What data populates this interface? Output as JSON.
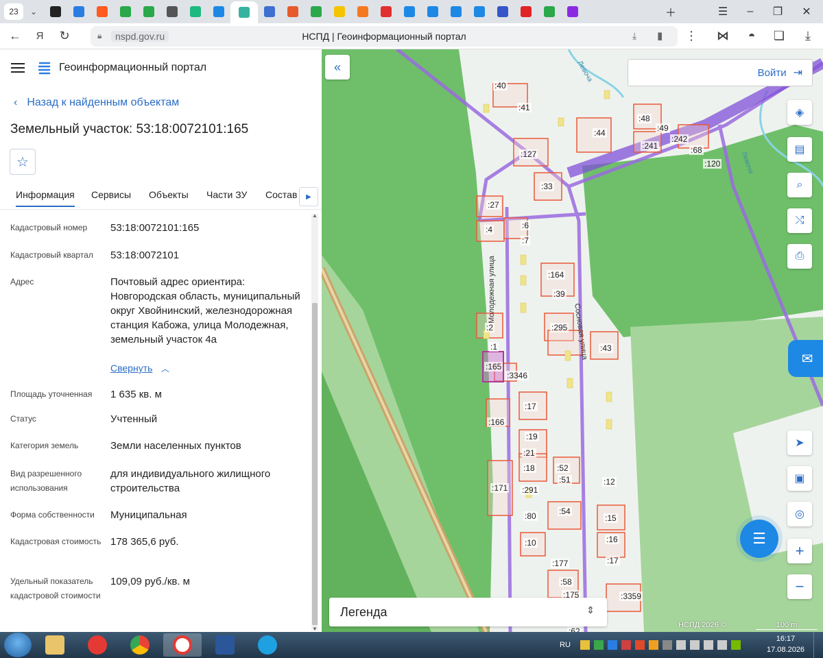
{
  "browser": {
    "tab_count": "23",
    "page_title": "НСПД | Геоинформационный портал",
    "url": "nspd.gov.ru",
    "favicon_colors": [
      "#222222",
      "#2a7de1",
      "#ff5a1f",
      "#2aa84a",
      "#2aa84a",
      "#555555",
      "#1eb980",
      "#1e88e5",
      "#35b3a0",
      "#3f6fd1",
      "#e65a2b",
      "#2aa84a",
      "#f5c400",
      "#f57a1f",
      "#e03030",
      "#1e88e5",
      "#1e88e5",
      "#1e88e5",
      "#1e88e5",
      "#3555c8",
      "#e02424",
      "#2aa84a",
      "#8a2be2"
    ]
  },
  "panel": {
    "portal_name": "Геоинформационный портал",
    "back_link": "Назад к найденным объектам",
    "title": "Земельный участок: 53:18:0072101:165",
    "tabs": [
      "Информация",
      "Сервисы",
      "Объекты",
      "Части ЗУ",
      "Состав"
    ],
    "fields": [
      {
        "label": "Кадастровый номер",
        "value": "53:18:0072101:165"
      },
      {
        "label": "Кадастровый квартал",
        "value": "53:18:0072101"
      },
      {
        "label": "Адрес",
        "value": "Почтовый адрес ориентира: Новгородская область, муниципальный округ Хвойнинский, железнодорожная станция Кабожа, улица Молодежная, земельный участок 4а",
        "action": "Свернуть"
      },
      {
        "label": "Площадь уточненная",
        "value": "1 635 кв. м"
      },
      {
        "label": "Статус",
        "value": "Учтенный"
      },
      {
        "label": "Категория земель",
        "value": "Земли населенных пунктов"
      },
      {
        "label": "Вид разрешенного использования",
        "value": "для индивидуального жилищного строительства"
      },
      {
        "label": "Форма собственности",
        "value": "Муниципальная"
      },
      {
        "label": "Кадастровая стоимость",
        "value": "178 365,6 руб."
      },
      {
        "label": "Удельный показатель кадастровой стоимости",
        "value": "109,09 руб./кв. м"
      }
    ]
  },
  "map": {
    "login": "Войти",
    "legend": "Легенда",
    "attribution": "НСПД 2026 ©",
    "scale": "100 m",
    "streets": [
      "Молодежная улица",
      "Сосновая улица",
      "Левоча",
      "Левоча"
    ],
    "parcels": [
      ":40",
      ":41",
      ":44",
      ":48",
      ":49",
      ":241",
      ":242",
      ":68",
      ":120",
      ":127",
      ":33",
      ":27",
      ":4",
      ":6",
      ":7",
      ":164",
      ":39",
      ":2",
      ":295",
      ":43",
      ":1",
      ":165",
      ":3346",
      ":17",
      ":166",
      ":19",
      ":21",
      ":18",
      ":52",
      ":51",
      ":12",
      ":171",
      ":291",
      ":54",
      ":80",
      ":15",
      ":16",
      ":10",
      ":17",
      ":177",
      ":58",
      ":175",
      ":3359",
      ":62"
    ],
    "colors": {
      "green": "#6fbf6a",
      "light_green": "#a6d59b",
      "parcel": "#e9593a",
      "road": "#9a6be0",
      "selected": "#c96bcf",
      "railway": "#c9a46a"
    }
  },
  "taskbar": {
    "lang": "RU",
    "time": "16:17",
    "date": "17.08.2026"
  }
}
